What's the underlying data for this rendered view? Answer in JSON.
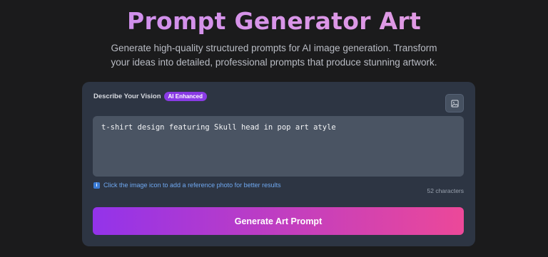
{
  "header": {
    "title": "Prompt Generator Art",
    "subtitle": "Generate high-quality structured prompts for AI image generation. Transform your ideas into detailed, professional prompts that produce stunning artwork."
  },
  "form": {
    "label": "Describe Your Vision",
    "badge": "AI Enhanced",
    "image_button_icon": "image-icon",
    "input_value": "t-shirt design featuring Skull head in pop art atyle",
    "hint_icon": "info-icon",
    "hint": "Click the image icon to add a reference photo for better results",
    "char_count": "52 characters",
    "submit_label": "Generate Art Prompt"
  },
  "colors": {
    "background": "#1b1b1c",
    "card": "#2d3543",
    "badge": "#8a3be5",
    "button_gradient_start": "#9333ea",
    "button_gradient_end": "#ec4899"
  }
}
